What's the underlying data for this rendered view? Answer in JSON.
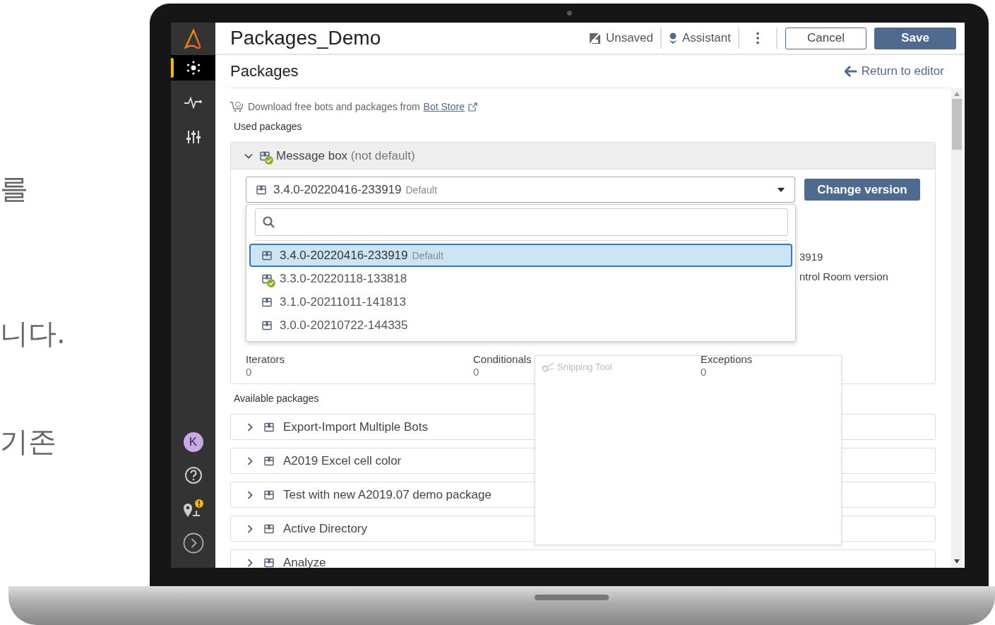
{
  "background_text": [
    "를",
    "니다.",
    "기존"
  ],
  "sidebar": {
    "nav": [
      {
        "selected": true
      },
      {
        "selected": false
      },
      {
        "selected": false
      }
    ],
    "avatar": "K"
  },
  "header": {
    "title": "Packages_Demo",
    "status": "Unsaved",
    "assistant": "Assistant",
    "cancel": "Cancel",
    "save": "Save"
  },
  "page": {
    "title": "Packages",
    "return_link": "Return to editor"
  },
  "bot_store": {
    "text": "Download free bots and packages from",
    "link": "Bot Store"
  },
  "used_packages": {
    "heading": "Used packages",
    "packages": [
      {
        "name": "Message box",
        "note": "(not default)",
        "expanded": true,
        "version": "3.4.0-20220416-233919",
        "version_tag": "Default",
        "change_button": "Change version",
        "details": [
          "3919",
          "ntrol Room version"
        ],
        "stats": [
          {
            "label": "Iterators",
            "value": "0"
          },
          {
            "label": "Conditionals",
            "value": "0"
          },
          {
            "label": "Exceptions",
            "value": "0"
          }
        ]
      }
    ]
  },
  "version_dropdown": {
    "options": [
      {
        "version": "3.4.0-20220416-233919",
        "tag": "Default",
        "selected": true,
        "in_use": false
      },
      {
        "version": "3.3.0-20220118-133818",
        "selected": false,
        "in_use": true
      },
      {
        "version": "3.1.0-20211011-141813",
        "selected": false,
        "in_use": false
      },
      {
        "version": "3.0.0-20210722-144335",
        "selected": false,
        "in_use": false
      }
    ]
  },
  "available_packages": {
    "heading": "Available packages",
    "packages": [
      {
        "name": "Export-Import Multiple Bots",
        "expanded": false
      },
      {
        "name": "A2019 Excel cell color",
        "expanded": false
      },
      {
        "name": "Test with new A2019.07 demo package",
        "expanded": false
      },
      {
        "name": "Active Directory",
        "expanded": false
      },
      {
        "name": "Analyze",
        "expanded": false
      }
    ]
  },
  "overlay_window": {
    "title": "Snipping Tool"
  }
}
